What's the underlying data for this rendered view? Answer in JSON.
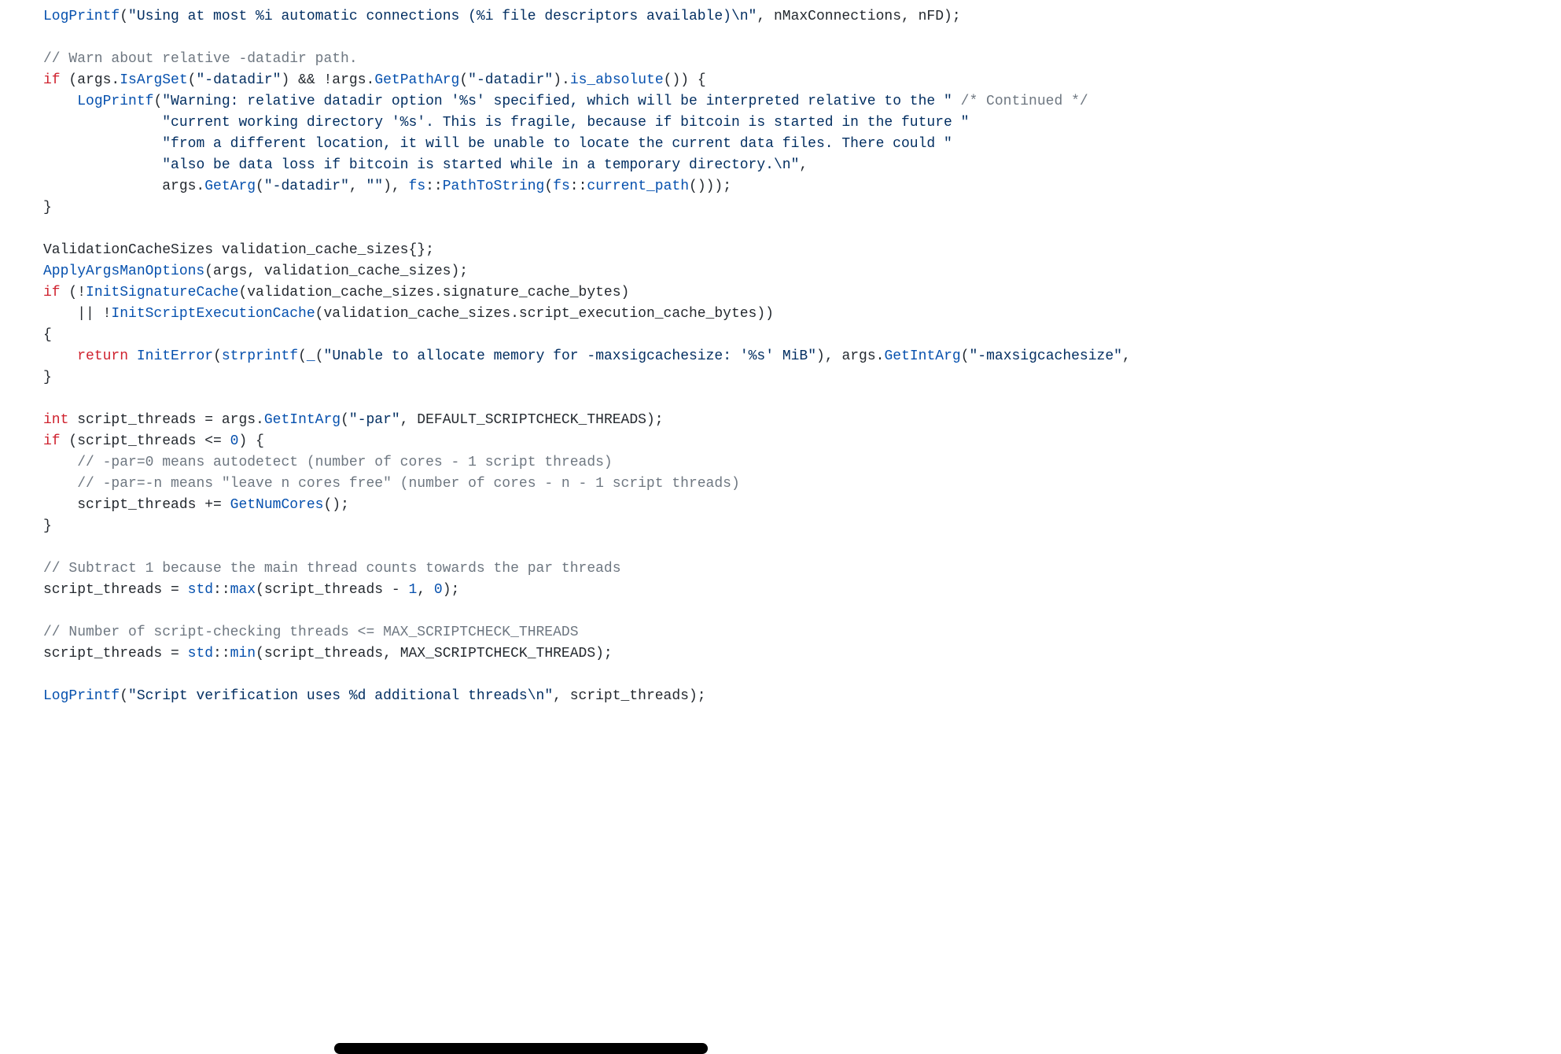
{
  "lines": {
    "l1a": "LogPrintf",
    "l1b": "(",
    "l1c": "\"Using at most %i automatic connections (%i file descriptors available)\\n\"",
    "l1d": ", nMaxConnections, nFD);",
    "l3a": "// Warn about relative -datadir path.",
    "l4a": "if",
    "l4b": " (args.",
    "l4c": "IsArgSet",
    "l4d": "(",
    "l4e": "\"-datadir\"",
    "l4f": ") && !args.",
    "l4g": "GetPathArg",
    "l4h": "(",
    "l4i": "\"-datadir\"",
    "l4j": ").",
    "l4k": "is_absolute",
    "l4l": "()) {",
    "l5a": "    ",
    "l5b": "LogPrintf",
    "l5c": "(",
    "l5d": "\"Warning: relative datadir option '%s' specified, which will be interpreted relative to the \"",
    "l5e": " ",
    "l5f": "/* Continued */",
    "l6a": "              ",
    "l6b": "\"current working directory '%s'. This is fragile, because if bitcoin is started in the future \"",
    "l7a": "              ",
    "l7b": "\"from a different location, it will be unable to locate the current data files. There could \"",
    "l8a": "              ",
    "l8b": "\"also be data loss if bitcoin is started while in a temporary directory.\\n\"",
    "l8c": ",",
    "l9a": "              args.",
    "l9b": "GetArg",
    "l9c": "(",
    "l9d": "\"-datadir\"",
    "l9e": ", ",
    "l9f": "\"\"",
    "l9g": "), ",
    "l9h": "fs",
    "l9i": "::",
    "l9j": "PathToString",
    "l9k": "(",
    "l9l": "fs",
    "l9m": "::",
    "l9n": "current_path",
    "l9o": "()));",
    "l10": "}",
    "l12": "ValidationCacheSizes validation_cache_sizes{};",
    "l13a": "ApplyArgsManOptions",
    "l13b": "(args, validation_cache_sizes);",
    "l14a": "if",
    "l14b": " (!",
    "l14c": "InitSignatureCache",
    "l14d": "(validation_cache_sizes.signature_cache_bytes)",
    "l15a": "    || !",
    "l15b": "InitScriptExecutionCache",
    "l15c": "(validation_cache_sizes.script_execution_cache_bytes))",
    "l16": "{",
    "l17a": "    ",
    "l17b": "return",
    "l17c": " ",
    "l17d": "InitError",
    "l17e": "(",
    "l17f": "strprintf",
    "l17g": "(",
    "l17h": "_",
    "l17i": "(",
    "l17j": "\"Unable to allocate memory for -maxsigcachesize: '%s' MiB\"",
    "l17k": "), args.",
    "l17l": "GetIntArg",
    "l17m": "(",
    "l17n": "\"-maxsigcachesize\"",
    "l17o": ",",
    "l18": "}",
    "l20a": "int",
    "l20b": " script_threads = args.",
    "l20c": "GetIntArg",
    "l20d": "(",
    "l20e": "\"-par\"",
    "l20f": ", DEFAULT_SCRIPTCHECK_THREADS);",
    "l21a": "if",
    "l21b": " (script_threads <= ",
    "l21c": "0",
    "l21d": ") {",
    "l22a": "    ",
    "l22b": "// -par=0 means autodetect (number of cores - 1 script threads)",
    "l23a": "    ",
    "l23b": "// -par=-n means \"leave n cores free\" (number of cores - n - 1 script threads)",
    "l24a": "    script_threads += ",
    "l24b": "GetNumCores",
    "l24c": "();",
    "l25": "}",
    "l27": "// Subtract 1 because the main thread counts towards the par threads",
    "l28a": "script_threads = ",
    "l28b": "std",
    "l28c": "::",
    "l28d": "max",
    "l28e": "(script_threads - ",
    "l28f": "1",
    "l28g": ", ",
    "l28h": "0",
    "l28i": ");",
    "l30": "// Number of script-checking threads <= MAX_SCRIPTCHECK_THREADS",
    "l31a": "script_threads = ",
    "l31b": "std",
    "l31c": "::",
    "l31d": "min",
    "l31e": "(script_threads, MAX_SCRIPTCHECK_THREADS);",
    "l33a": "LogPrintf",
    "l33b": "(",
    "l33c": "\"Script verification uses %d additional threads\\n\"",
    "l33d": ", script_threads);"
  }
}
